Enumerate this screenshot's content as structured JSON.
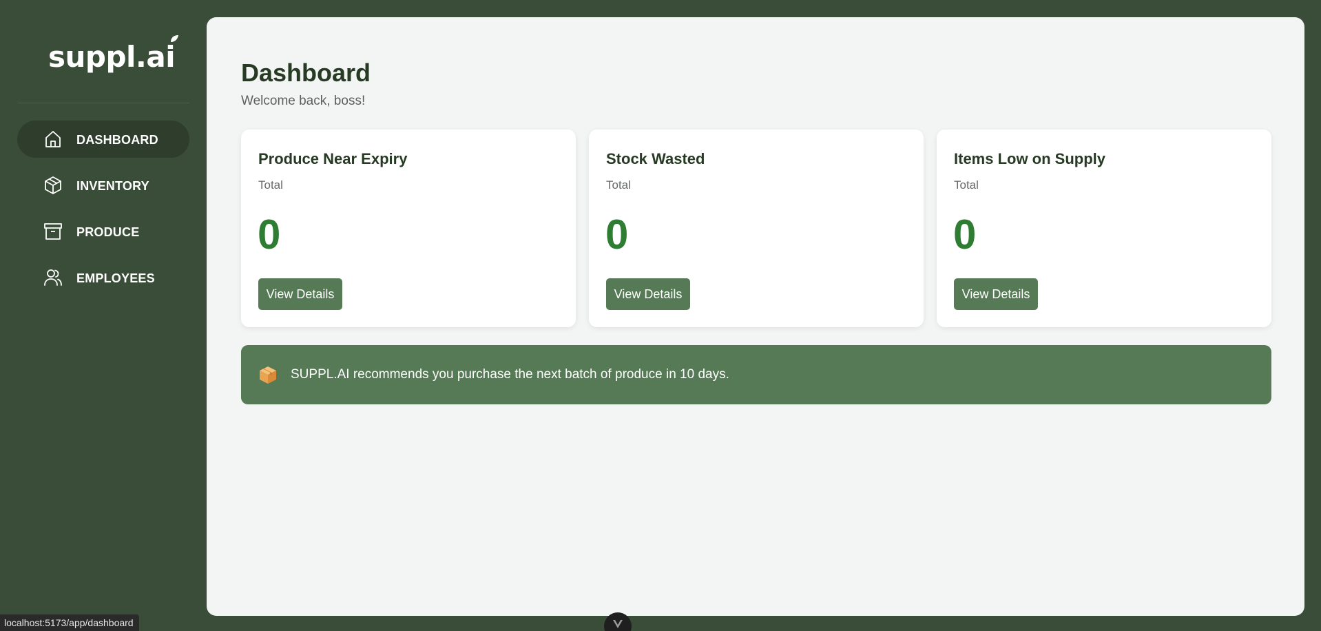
{
  "app": {
    "logo_text": "suppl.ai"
  },
  "sidebar": {
    "items": [
      {
        "label": "DASHBOARD",
        "icon": "home-icon",
        "active": true
      },
      {
        "label": "INVENTORY",
        "icon": "box-3d-icon",
        "active": false
      },
      {
        "label": "PRODUCE",
        "icon": "archive-icon",
        "active": false
      },
      {
        "label": "EMPLOYEES",
        "icon": "users-icon",
        "active": false
      }
    ]
  },
  "main": {
    "title": "Dashboard",
    "subtitle": "Welcome back, boss!",
    "cards": [
      {
        "title": "Produce Near Expiry",
        "sub": "Total",
        "value": "0",
        "button": "View Details"
      },
      {
        "title": "Stock Wasted",
        "sub": "Total",
        "value": "0",
        "button": "View Details"
      },
      {
        "title": "Items Low on Supply",
        "sub": "Total",
        "value": "0",
        "button": "View Details"
      }
    ],
    "recommendation": {
      "icon": "package-icon",
      "text": "SUPPL.AI recommends you purchase the next batch of produce in 10 days."
    }
  },
  "status": {
    "url": "localhost:5173/app/dashboard"
  },
  "colors": {
    "sidebar_bg": "#3a4d38",
    "active_nav_bg": "#2e3d2c",
    "accent_green": "#557a55",
    "value_green": "#2e7d32",
    "heading": "#263a24"
  }
}
